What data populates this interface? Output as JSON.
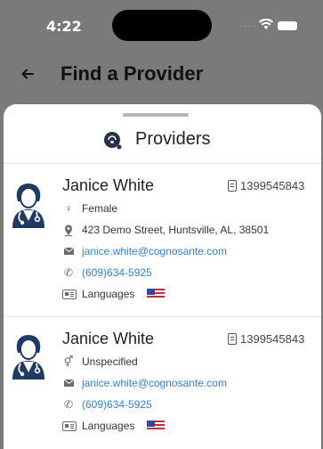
{
  "status_bar": {
    "time": "4:22",
    "signal_dots": "....",
    "wifi_icon": "wifi-icon",
    "battery_icon": "battery-icon"
  },
  "nav": {
    "back_icon": "arrow-left-icon",
    "title": "Find a Provider"
  },
  "sheet": {
    "icon": "providers-icon",
    "title": "Providers"
  },
  "providers": [
    {
      "name": "Janice White",
      "npi": "1399545843",
      "gender": "Female",
      "gender_icon": "female-icon",
      "address": "423 Demo Street, Huntsville, AL, 38501",
      "email": "janice.white@cognosante.com",
      "phone": "(609)634-5925",
      "languages_label": "Languages",
      "language_flag": "us-flag-icon"
    },
    {
      "name": "Janice White",
      "npi": "1399545843",
      "gender": "Unspecified",
      "gender_icon": "gender-unspecified-icon",
      "email": "janice.white@cognosante.com",
      "phone": "(609)634-5925",
      "languages_label": "Languages",
      "language_flag": "us-flag-icon"
    }
  ],
  "colors": {
    "link": "#2f7fd8",
    "overlay": "#7a7a7a",
    "avatar": "#1f3b63"
  }
}
